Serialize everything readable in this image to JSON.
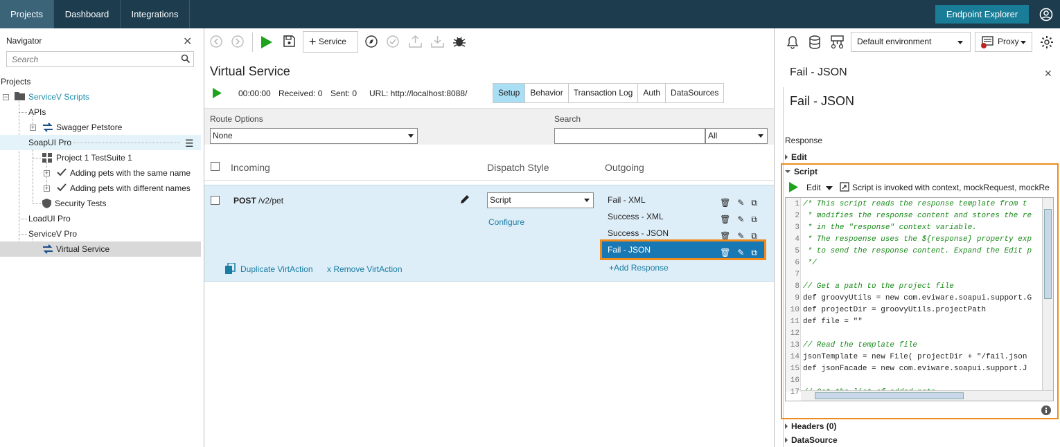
{
  "topnav": {
    "projects": "Projects",
    "dashboard": "Dashboard",
    "integrations": "Integrations",
    "endpoint_explorer": "Endpoint Explorer"
  },
  "navigator": {
    "title": "Navigator",
    "search_placeholder": "Search",
    "projects_label": "Projects",
    "tree": {
      "servicev_scripts": "ServiceV Scripts",
      "apis": "APIs",
      "swagger_petstore": "Swagger Petstore",
      "soapui_pro": "SoapUI Pro",
      "project1_testsuite": "Project 1 TestSuite 1",
      "adding_same": "Adding pets with the same name",
      "adding_different": "Adding pets with different names",
      "security_tests": "Security Tests",
      "loadui_pro": "LoadUI Pro",
      "servicev_pro": "ServiceV Pro",
      "virtual_service": "Virtual Service"
    }
  },
  "toolbar": {
    "service_label": "Service",
    "environment": "Default environment",
    "proxy": "Proxy"
  },
  "virtual_service": {
    "title": "Virtual Service",
    "time": "00:00:00",
    "received": "Received: 0",
    "sent": "Sent: 0",
    "url": "URL: http://localhost:8088/",
    "tabs": [
      "Setup",
      "Behavior",
      "Transaction Log",
      "Auth",
      "DataSources"
    ]
  },
  "filters": {
    "route_options_label": "Route Options",
    "route_options_value": "None",
    "search_label": "Search",
    "search_value": "",
    "search_scope": "All"
  },
  "columns": {
    "incoming": "Incoming",
    "dispatch": "Dispatch Style",
    "outgoing": "Outgoing"
  },
  "action": {
    "method": "POST",
    "path": "/v2/pet",
    "dispatch_value": "Script",
    "configure": "Configure",
    "duplicate": "Duplicate VirtAction",
    "remove": "x Remove VirtAction",
    "responses": [
      "Fail - XML",
      "Success - XML",
      "Success - JSON",
      "Fail - JSON"
    ],
    "add_response": "+Add Response"
  },
  "right_panel": {
    "header": "Fail - JSON",
    "title": "Fail - JSON",
    "response_label": "Response",
    "edit_section": "Edit",
    "script_section": "Script",
    "edit_menu": "Edit",
    "script_info": "Script is invoked with context, mockRequest, mockRe",
    "headers_section": "Headers (0)",
    "datasource_section": "DataSource"
  },
  "script_lines": [
    {
      "n": "1",
      "t": "/* This script reads the response template from t",
      "c": "cm"
    },
    {
      "n": "2",
      "t": " * modifies the response content and stores the re",
      "c": "cm"
    },
    {
      "n": "3",
      "t": " * in the \"response\" context variable.",
      "c": "cm"
    },
    {
      "n": "4",
      "t": " * The respoense uses the ${response} property exp",
      "c": "cm"
    },
    {
      "n": "5",
      "t": " * to send the response content. Expand the Edit p",
      "c": "cm"
    },
    {
      "n": "6",
      "t": " */",
      "c": "cm"
    },
    {
      "n": "7",
      "t": "",
      "c": ""
    },
    {
      "n": "8",
      "t": "// Get a path to the project file",
      "c": "cm"
    },
    {
      "n": "9",
      "t": "def groovyUtils = new com.eviware.soapui.support.G",
      "c": ""
    },
    {
      "n": "10",
      "t": "def projectDir = groovyUtils.projectPath",
      "c": ""
    },
    {
      "n": "11",
      "t": "def file = \"\"",
      "c": ""
    },
    {
      "n": "12",
      "t": "",
      "c": ""
    },
    {
      "n": "13",
      "t": "// Read the template file",
      "c": "cm"
    },
    {
      "n": "14",
      "t": "jsonTemplate = new File( projectDir + \"/fail.json",
      "c": ""
    },
    {
      "n": "15",
      "t": "def jsonFacade = new com.eviware.soapui.support.J",
      "c": ""
    },
    {
      "n": "16",
      "t": "",
      "c": ""
    },
    {
      "n": "17",
      "t": "// Get the list of added pets",
      "c": "cm"
    }
  ]
}
